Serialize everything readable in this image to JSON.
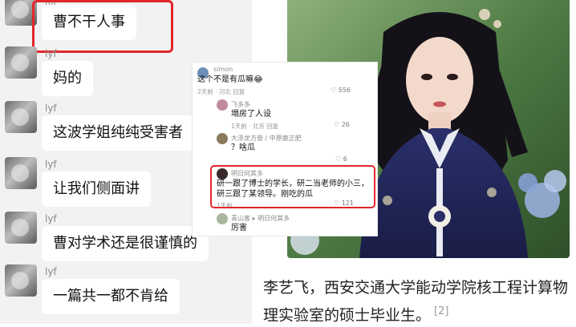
{
  "chat": {
    "messages": [
      {
        "sender": "",
        "text": "曹不干人事"
      },
      {
        "sender": "lyf",
        "text": "妈的"
      },
      {
        "sender": "lyf",
        "text": "这波学姐纯纯受害者"
      },
      {
        "sender": "lyf",
        "text": "让我们侧面讲"
      },
      {
        "sender": "lyf",
        "text": "曹对学术还是很谨慎的"
      },
      {
        "sender": "lyf",
        "text": "一篇共一都不肯给"
      }
    ],
    "top_sender": "lyf"
  },
  "article": {
    "caption": "李艺飞，西安交通大学能动学院核工程计算物理实验室的硕士毕业生。",
    "citation": "[2]"
  },
  "comments": {
    "items": [
      {
        "user": "simon",
        "text": "这个不是有瓜嘛😂",
        "meta": "2天前 · 河北  回复",
        "likes": "556"
      },
      {
        "user": "飞多多",
        "text": "塌房了人设",
        "meta": "1天前 · 北京  回复",
        "likes": "26"
      },
      {
        "user": "大泽龙方奋 / 中原鹿正肥",
        "text": "？啥瓜",
        "meta": "",
        "likes": "6"
      },
      {
        "user": "明日何其多",
        "text": "研一跟了博士的学长，研二当老师的小三，研三跟了某领导。刚吃的瓜",
        "meta": "1天前",
        "likes": "121"
      },
      {
        "user": "青山客 ▸ 明日何其多",
        "text": "厉害",
        "meta": "",
        "likes": ""
      }
    ]
  },
  "colors": {
    "highlight": "#e3262b",
    "chat_bg": "#f2f2f2",
    "bubble": "#ffffff"
  }
}
